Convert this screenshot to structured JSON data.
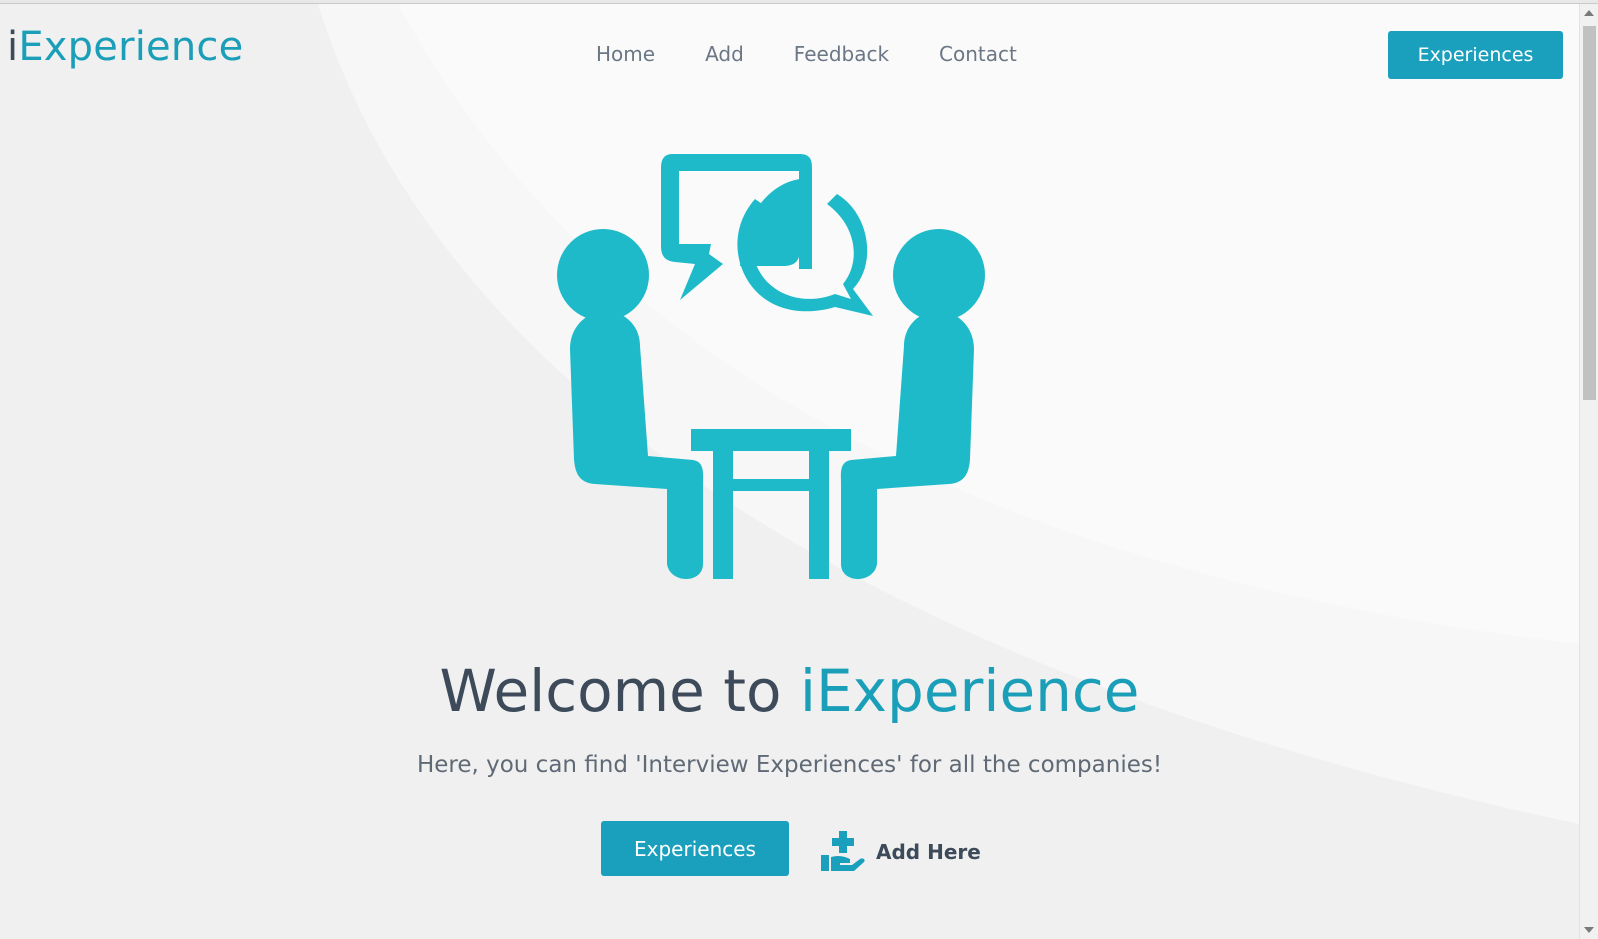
{
  "brand": {
    "prefix": "i",
    "name": "Experience"
  },
  "nav": {
    "items": [
      {
        "label": "Home"
      },
      {
        "label": "Add"
      },
      {
        "label": "Feedback"
      },
      {
        "label": "Contact"
      }
    ]
  },
  "header": {
    "cta_label": "Experiences"
  },
  "hero": {
    "title_prefix": "Welcome to ",
    "title_brand": "iExperience",
    "subtitle": "Here, you can find 'Interview Experiences' for all the companies!",
    "primary_label": "Experiences",
    "secondary_label": "Add Here",
    "illustration_icon": "interview-meeting-icon",
    "secondary_icon": "hand-plus-icon"
  },
  "colors": {
    "accent": "#1aa0bd",
    "illustration": "#1fbac9",
    "text_dark": "#3c4a5a",
    "text_muted": "#6b7785"
  }
}
